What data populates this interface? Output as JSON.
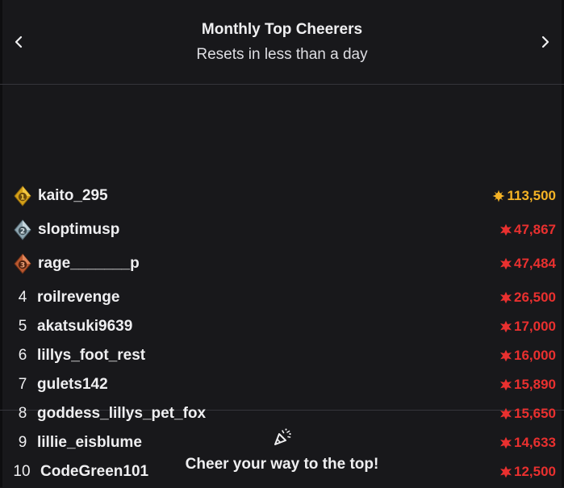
{
  "header": {
    "title": "Monthly Top Cheerers",
    "subtitle": "Resets in less than a day",
    "prev_icon": "chevron-left-icon",
    "next_icon": "chevron-right-icon"
  },
  "leaderboard": [
    {
      "rank": "1",
      "name": "kaito_295",
      "amount": "113,500",
      "badge": "gold",
      "tier": "gold-bits-icon",
      "color": "#f5b325"
    },
    {
      "rank": "2",
      "name": "sloptimusp",
      "amount": "47,867",
      "badge": "silver",
      "tier": "red-bits-icon",
      "color": "#e9302f"
    },
    {
      "rank": "3",
      "name": "rage_______p",
      "amount": "47,484",
      "badge": "bronze",
      "tier": "red-bits-icon",
      "color": "#e9302f"
    },
    {
      "rank": "4",
      "name": "roilrevenge",
      "amount": "26,500",
      "badge": "",
      "tier": "red-bits-icon",
      "color": "#e9302f"
    },
    {
      "rank": "5",
      "name": "akatsuki9639",
      "amount": "17,000",
      "badge": "",
      "tier": "red-bits-icon",
      "color": "#e9302f"
    },
    {
      "rank": "6",
      "name": "lillys_foot_rest",
      "amount": "16,000",
      "badge": "",
      "tier": "red-bits-icon",
      "color": "#e9302f"
    },
    {
      "rank": "7",
      "name": "gulets142",
      "amount": "15,890",
      "badge": "",
      "tier": "red-bits-icon",
      "color": "#e9302f"
    },
    {
      "rank": "8",
      "name": "goddess_lillys_pet_fox",
      "amount": "15,650",
      "badge": "",
      "tier": "red-bits-icon",
      "color": "#e9302f"
    },
    {
      "rank": "9",
      "name": "lillie_eisblume",
      "amount": "14,633",
      "badge": "",
      "tier": "red-bits-icon",
      "color": "#e9302f"
    },
    {
      "rank": "10",
      "name": "CodeGreen101",
      "amount": "12,500",
      "badge": "",
      "tier": "red-bits-icon",
      "color": "#e9302f"
    }
  ],
  "footer": {
    "icon": "party-popper-icon",
    "text": "Cheer your way to the top!"
  },
  "colors": {
    "background": "#18181b",
    "divider": "#35353b",
    "gold_bits": "#f5b325",
    "red_bits": "#e9302f",
    "badge_gold": "#d4a017",
    "badge_silver": "#9fb3bd",
    "badge_bronze": "#c0603a"
  }
}
